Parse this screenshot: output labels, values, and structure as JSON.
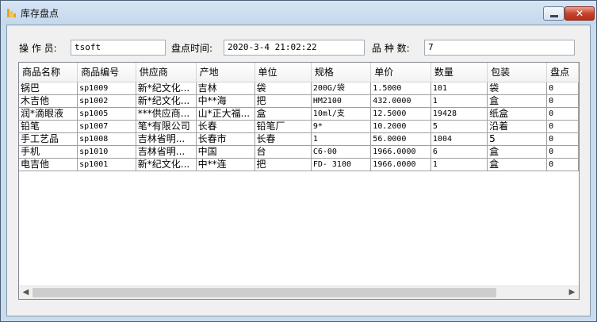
{
  "window": {
    "title": "库存盘点",
    "minimize_glyph": "",
    "close_glyph": "✕"
  },
  "form": {
    "operator_label": "操 作 员:",
    "operator_value": "tsoft",
    "time_label": "盘点时间:",
    "time_value": "2020-3-4 21:02:22",
    "kinds_label": "品 种 数:",
    "kinds_value": "7"
  },
  "grid": {
    "columns": [
      "商品名称",
      "商品编号",
      "供应商",
      "产地",
      "单位",
      "规格",
      "单价",
      "数量",
      "包装",
      "盘点"
    ],
    "rows": [
      [
        "锅巴",
        "sp1009",
        "新*纪文化...",
        "吉林",
        "袋",
        "200G/袋",
        "1.5000",
        "101",
        "袋",
        "0"
      ],
      [
        "木吉他",
        "sp1002",
        "新*纪文化...",
        "中**海",
        "把",
        "HM2100",
        "432.0000",
        "1",
        "盒",
        "0"
      ],
      [
        "润*滴眼液",
        "sp1005",
        "***供应商...",
        "山*正大福...",
        "盒",
        "10ml/支",
        "12.5000",
        "19428",
        "纸盒",
        "0"
      ],
      [
        "铅笔",
        "sp1007",
        "笔*有限公司",
        "长春",
        "铅笔厂",
        "9*",
        "10.2000",
        "5",
        "沿着",
        "0"
      ],
      [
        "手工艺品",
        "sp1008",
        "吉林省明...",
        "长春市",
        "长春",
        "1",
        "56.0000",
        "1004",
        "5",
        "0"
      ],
      [
        "手机",
        "sp1010",
        "吉林省明...",
        "中国",
        "台",
        "C6-00",
        "1966.0000",
        "6",
        "盒",
        "0"
      ],
      [
        "电吉他",
        "sp1001",
        "新*纪文化...",
        "中**连",
        "把",
        "FD- 3100",
        "1966.0000",
        "1",
        "盒",
        "0"
      ]
    ],
    "scroll_left": "◀",
    "scroll_right": "▶"
  }
}
